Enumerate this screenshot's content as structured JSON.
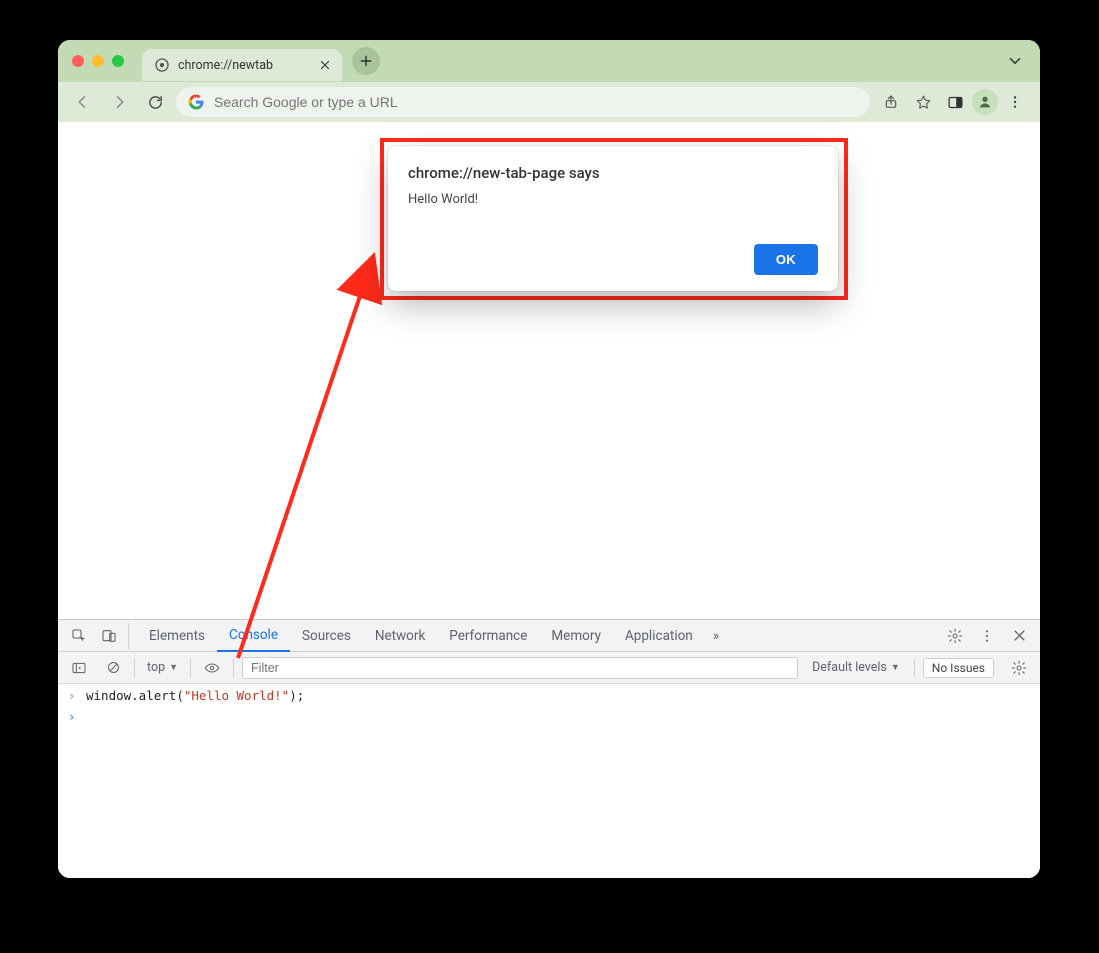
{
  "tabstrip": {
    "tab_title": "chrome://newtab"
  },
  "omnibox": {
    "placeholder": "Search Google or type a URL"
  },
  "alert": {
    "title": "chrome://new-tab-page says",
    "message": "Hello World!",
    "ok_label": "OK"
  },
  "devtools": {
    "tabs": [
      "Elements",
      "Console",
      "Sources",
      "Network",
      "Performance",
      "Memory",
      "Application"
    ],
    "active_tab_index": 1,
    "more_tabs_glyph": "»",
    "filterbar": {
      "context": "top",
      "filter_placeholder": "Filter",
      "levels_label": "Default levels",
      "issues_label": "No Issues"
    },
    "console": {
      "line1_fn": "window.alert",
      "line1_open": "(",
      "line1_str": "\"Hello World!\"",
      "line1_close": ");"
    }
  }
}
